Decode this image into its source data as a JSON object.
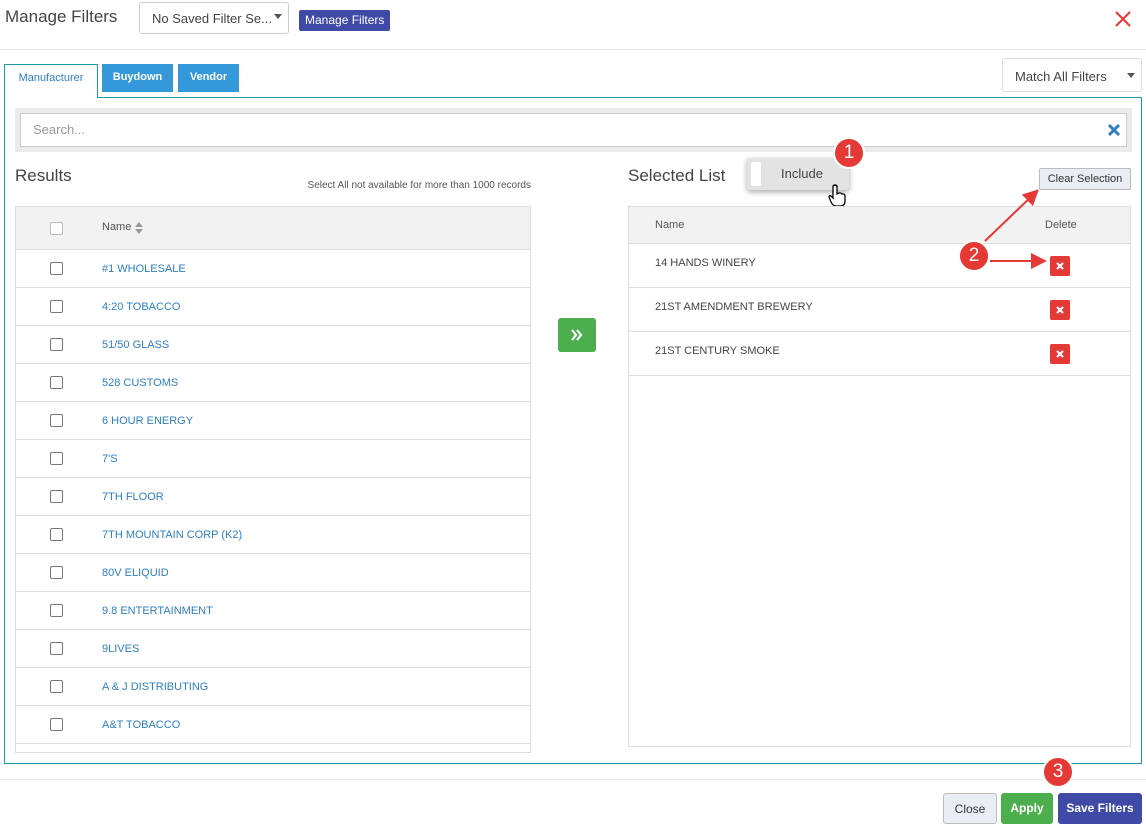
{
  "header": {
    "title": "Manage Filters",
    "saved_filter": "No Saved Filter Se...",
    "manage_button": "Manage Filters"
  },
  "tabs": [
    {
      "label": "Manufacturer",
      "active": true
    },
    {
      "label": "Buydown",
      "active": false
    },
    {
      "label": "Vendor",
      "active": false
    }
  ],
  "match_select": "Match All Filters",
  "search": {
    "placeholder": "Search..."
  },
  "results": {
    "title": "Results",
    "note": "Select All not available for more than 1000 records",
    "column_name": "Name",
    "rows": [
      "#1 WHOLESALE",
      "4:20 TOBACCO",
      "51/50 GLASS",
      "528 CUSTOMS",
      "6 HOUR ENERGY",
      "7'S",
      "7TH FLOOR",
      "7TH MOUNTAIN CORP (K2)",
      "80V ELIQUID",
      "9.8 ENTERTAINMENT",
      "9LIVES",
      "A & J DISTRIBUTING",
      "A&T TOBACCO"
    ]
  },
  "selected": {
    "title": "Selected List",
    "toggle_label": "Include",
    "clear_button": "Clear Selection",
    "column_name": "Name",
    "column_delete": "Delete",
    "rows": [
      "14 HANDS WINERY",
      "21ST AMENDMENT BREWERY",
      "21ST CENTURY SMOKE"
    ]
  },
  "footer": {
    "close": "Close",
    "apply": "Apply",
    "save": "Save Filters"
  },
  "annotations": {
    "badge1": "1",
    "badge2": "2",
    "badge3": "3",
    "color": "#e53935"
  },
  "icons": {
    "close": "close-x-icon",
    "search_clear": "clear-x-icon",
    "sort": "sort-icon",
    "move": "double-chevron-right-icon",
    "delete": "delete-x-icon",
    "cursor": "hand-pointer-icon"
  }
}
